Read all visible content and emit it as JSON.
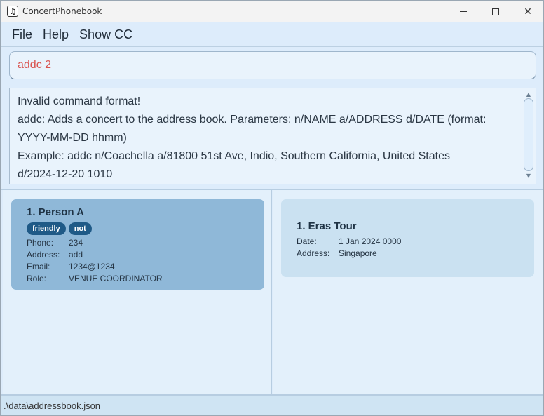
{
  "window": {
    "title": "ConcertPhonebook",
    "app_icon": "music-note-icon"
  },
  "menu": {
    "items": [
      "File",
      "Help",
      "Show CC"
    ]
  },
  "command": {
    "value": "addc 2",
    "text_color": "#d9534f"
  },
  "result": {
    "lines": [
      "Invalid command format!",
      "addc: Adds a concert to the address book. Parameters: n/NAME a/ADDRESS d/DATE (format:",
      "YYYY-MM-DD hhmm)",
      "Example: addc n/Coachella a/81800 51st Ave, Indio, Southern California, United States",
      "d/2024-12-20 1010"
    ]
  },
  "persons": [
    {
      "title": "1. Person A",
      "tags": [
        "friendly",
        "not"
      ],
      "fields": [
        {
          "label": "Phone:",
          "value": "234"
        },
        {
          "label": "Address:",
          "value": "add"
        },
        {
          "label": "Email:",
          "value": "1234@1234"
        },
        {
          "label": "Role:",
          "value": "VENUE COORDINATOR"
        }
      ]
    }
  ],
  "concerts": [
    {
      "title": "1. Eras Tour",
      "fields": [
        {
          "label": "Date:",
          "value": "1 Jan 2024 0000"
        },
        {
          "label": "Address:",
          "value": "Singapore"
        }
      ]
    }
  ],
  "status": {
    "path": ".\\data\\addressbook.json"
  },
  "colors": {
    "person_card": "#8fb8d8",
    "concert_card": "#cae1f1",
    "tag": "#1f5a87"
  }
}
